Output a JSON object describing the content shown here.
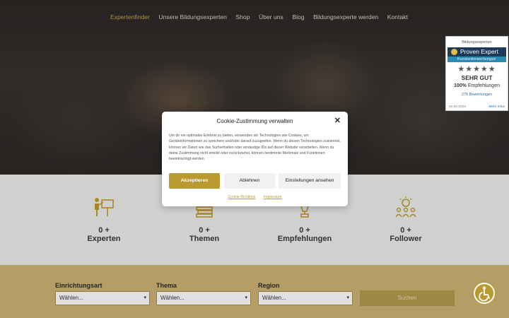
{
  "nav": {
    "items": [
      "Expertenfinder",
      "Unsere Bildungsexperten",
      "Shop",
      "Über uns",
      "Blog",
      "Bildungsexperte werden",
      "Kontakt"
    ],
    "active_index": 0
  },
  "stats": [
    {
      "num": "0 +",
      "label": "Experten",
      "icon": "presenter-board-icon"
    },
    {
      "num": "0 +",
      "label": "Themen",
      "icon": "books-stack-icon"
    },
    {
      "num": "0 +",
      "label": "Empfehlungen",
      "icon": "trophy-icon"
    },
    {
      "num": "0 +",
      "label": "Follower",
      "icon": "lightbulb-people-icon"
    }
  ],
  "search": {
    "fields": [
      {
        "label": "Einrichtungsart",
        "value": "Wählen..."
      },
      {
        "label": "Thema",
        "value": "Wählen..."
      },
      {
        "label": "Region",
        "value": "Wählen..."
      }
    ],
    "button": "Suchen"
  },
  "proven_expert": {
    "title": "Bildungsexperten",
    "brand": "Proven Expert",
    "subtitle": "Kundenbewertungen",
    "stars": "★★★★★",
    "grade": "SEHR GUT",
    "recommend_pct": "100%",
    "recommend_text": "Empfehlungen",
    "reviews": "275 Bewertungen",
    "date": "22.02.2026",
    "more": "Mehr Infos"
  },
  "cookie": {
    "title": "Cookie-Zustimmung verwalten",
    "body": "Um dir ein optimales Erlebnis zu bieten, verwenden wir Technologien wie Cookies, um Geräteinformationen zu speichern und/oder darauf zuzugreifen. Wenn du diesen Technologien zustimmst, können wir Daten wie das Surfverhalten oder eindeutige IDs auf dieser Website verarbeiten. Wenn du deine Zustimmung nicht erteilst oder zurückziehst, können bestimmte Merkmale und Funktionen beeinträchtigt werden.",
    "accept": "Akzeptieren",
    "deny": "Ablehnen",
    "settings": "Einstellungen ansehen",
    "policy_link": "Cookie-Richtlinie",
    "imprint_link": "Impressum"
  },
  "colors": {
    "gold": "#b99a2e",
    "search_bg": "#cdb474",
    "stats_bg": "#ededeb"
  }
}
